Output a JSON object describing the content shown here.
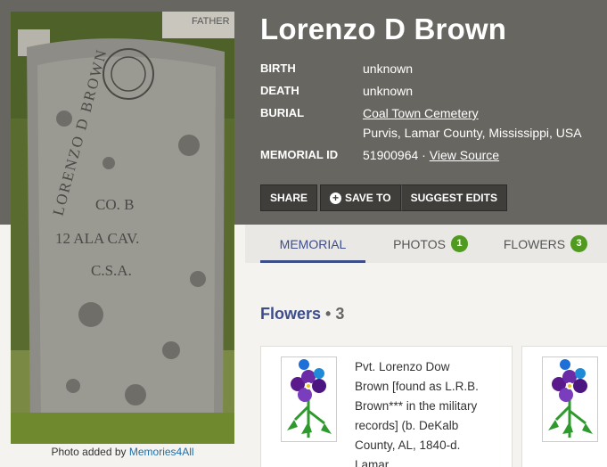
{
  "memorial": {
    "name": "Lorenzo D Brown",
    "facts": [
      {
        "label": "BIRTH",
        "value": "unknown"
      },
      {
        "label": "DEATH",
        "value": "unknown"
      }
    ],
    "burial": {
      "label": "BURIAL",
      "cemetery": "Coal Town Cemetery",
      "location": "Purvis, Lamar County, Mississippi, USA"
    },
    "memorial_id": {
      "label": "MEMORIAL ID",
      "value": "51900964",
      "separator": " · ",
      "link": "View Source"
    }
  },
  "photo": {
    "caption_prefix": "Photo added by ",
    "added_by": "Memories4All",
    "stone_sign": "FATHER",
    "inscription": [
      "LORENZO D BROWN",
      "CO. B",
      "12 ALA CAV.",
      "C.S.A."
    ]
  },
  "actions": {
    "share": "SHARE",
    "save_to": "SAVE TO",
    "suggest_edits": "SUGGEST EDITS"
  },
  "tabs": [
    {
      "label": "MEMORIAL",
      "badge": null,
      "active": true
    },
    {
      "label": "PHOTOS",
      "badge": "1",
      "active": false
    },
    {
      "label": "FLOWERS",
      "badge": "3",
      "active": false
    }
  ],
  "flowers": {
    "heading": "Flowers",
    "dot": " • ",
    "count": "3",
    "cards": [
      {
        "text": "Pvt. Lorenzo Dow Brown [found as L.R.B. Brown*** in the military records] (b. DeKalb County, AL, 1840-d. Lamar"
      },
      {
        "text": ""
      }
    ]
  },
  "colors": {
    "header_bg": "#686660",
    "accent": "#3d4d8a",
    "badge": "#4f9a1f",
    "link": "#1f6fa8"
  }
}
